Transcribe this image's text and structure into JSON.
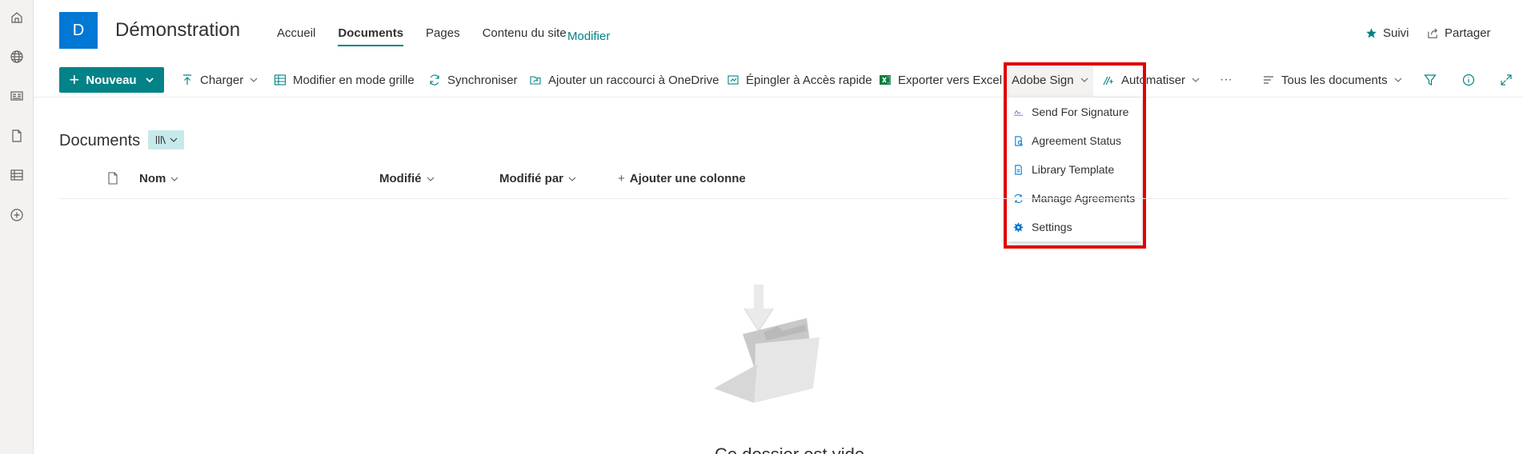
{
  "rail": {
    "icons": [
      "home-icon",
      "globe-icon",
      "news-icon",
      "document-icon",
      "list-icon",
      "add-circle-icon"
    ]
  },
  "header": {
    "logo_letter": "D",
    "site_title": "Démonstration",
    "nav": [
      "Accueil",
      "Documents",
      "Pages",
      "Contenu du site"
    ],
    "edit": "Modifier",
    "follow": "Suivi",
    "share": "Partager"
  },
  "commandbar": {
    "new": "Nouveau",
    "upload": "Charger",
    "grid_edit": "Modifier en mode grille",
    "sync": "Synchroniser",
    "add_shortcut": "Ajouter un raccourci à OneDrive",
    "pin_quick": "Épingler à Accès rapide",
    "export_excel": "Exporter vers Excel",
    "adobe_sign": "Adobe Sign",
    "automate": "Automatiser",
    "more": "···",
    "view": "Tous les documents"
  },
  "adobe_menu": {
    "items": [
      "Send For Signature",
      "Agreement Status",
      "Library Template",
      "Manage Agreements",
      "Settings"
    ]
  },
  "library": {
    "title": "Documents",
    "columns": {
      "name": "Nom",
      "modified": "Modifié",
      "modified_by": "Modifié par",
      "add_column": "Ajouter une colonne"
    },
    "empty_text": "Ce dossier est vide"
  },
  "colors": {
    "accent": "#038387",
    "logo": "#0078d4",
    "highlight": "#e00000"
  }
}
